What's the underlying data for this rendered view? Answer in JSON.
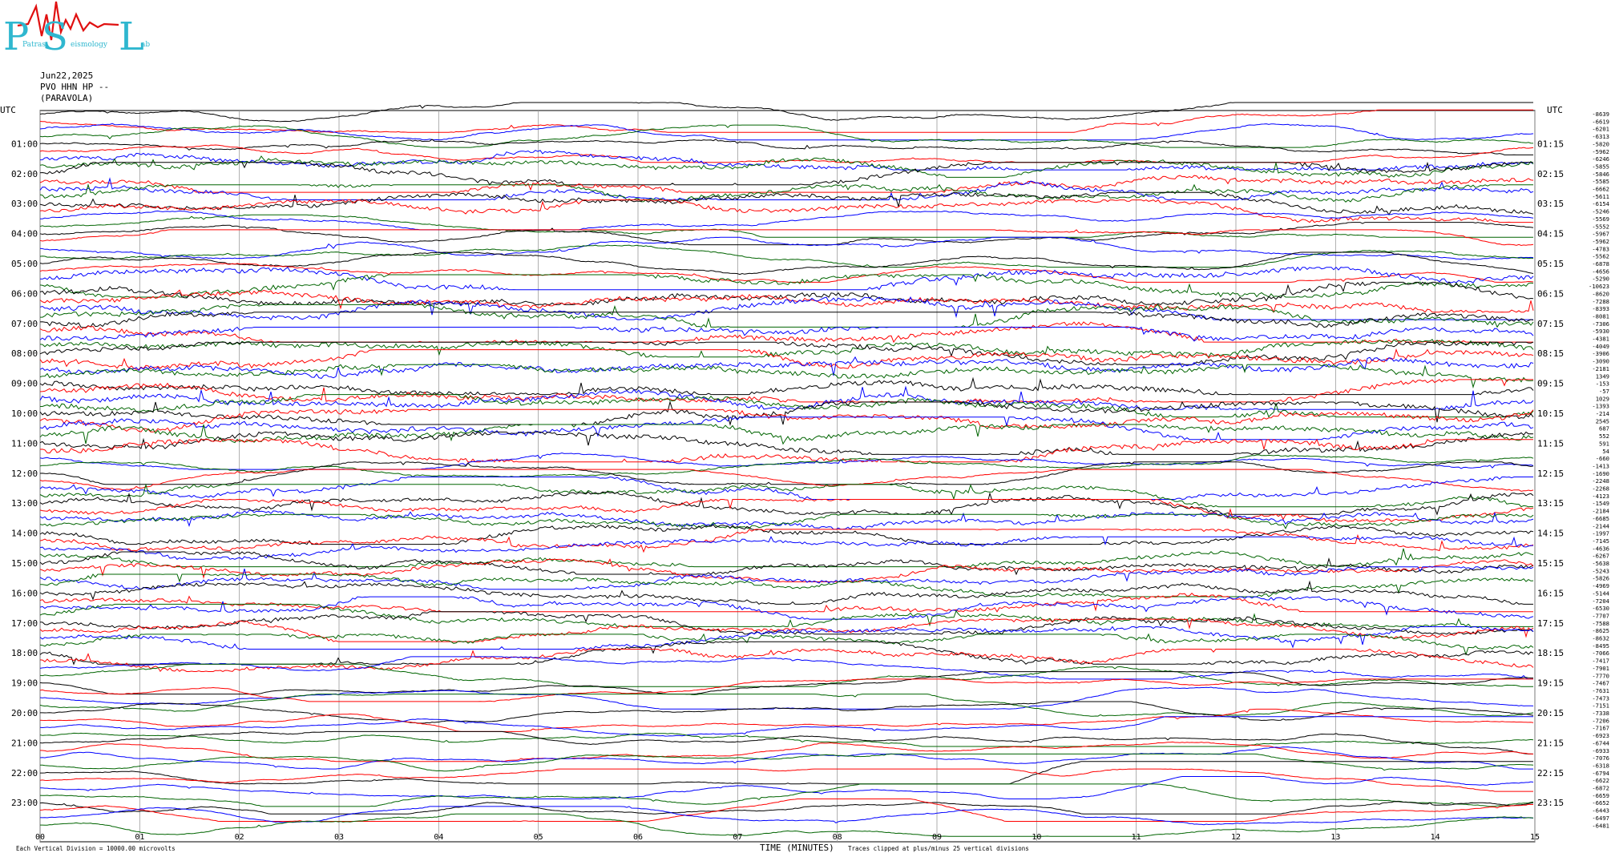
{
  "logo": {
    "big_letters": [
      "P",
      "S",
      "L"
    ],
    "small_words": [
      "Patras",
      "eismology",
      "ab"
    ],
    "colors": {
      "letters": "#2fb7cf",
      "waveform": "#e01010"
    }
  },
  "header": {
    "date": "Jun22,2025",
    "station": "PVO HHN HP --",
    "location": "(PARAVOLA)"
  },
  "axis": {
    "left_label": "UTC",
    "right_label": "UTC",
    "left_hours": [
      "01:00",
      "02:00",
      "03:00",
      "04:00",
      "05:00",
      "06:00",
      "07:00",
      "08:00",
      "09:00",
      "10:00",
      "11:00",
      "12:00",
      "13:00",
      "14:00",
      "15:00",
      "16:00",
      "17:00",
      "18:00",
      "19:00",
      "20:00",
      "21:00",
      "22:00",
      "23:00"
    ],
    "right_hours": [
      "01:15",
      "02:15",
      "03:15",
      "04:15",
      "05:15",
      "06:15",
      "07:15",
      "08:15",
      "09:15",
      "10:15",
      "11:15",
      "12:15",
      "13:15",
      "14:15",
      "15:15",
      "16:15",
      "17:15",
      "18:15",
      "19:15",
      "20:15",
      "21:15",
      "22:15",
      "23:15"
    ],
    "minute_ticks": [
      "00",
      "01",
      "02",
      "03",
      "04",
      "05",
      "06",
      "07",
      "08",
      "09",
      "10",
      "11",
      "12",
      "13",
      "14",
      "15"
    ],
    "xlabel": "TIME (MINUTES)"
  },
  "footer": {
    "scale_note": "Each Vertical Division = 10000.00 microvolts",
    "clip_note": "Traces clipped at plus/minus 25 vertical divisions"
  },
  "trace_colors": [
    "#000000",
    "#ff0000",
    "#0000ff",
    "#006400"
  ],
  "row_values": [
    "-8639",
    "-6619",
    "-6201",
    "-6313",
    "-5820",
    "-5962",
    "-6246",
    "-5855",
    "-5846",
    "-5585",
    "-6662",
    "-5611",
    "-6154",
    "-5246",
    "-5569",
    "-5552",
    "-5967",
    "-5962",
    "-4783",
    "-5562",
    "-6878",
    "-4656",
    "-5290",
    "-10623",
    "-8620",
    "-7288",
    "-8393",
    "-8081",
    "-7306",
    "-5930",
    "-4381",
    "-4049",
    "-3906",
    "-3090",
    "-2181",
    "1349",
    "-153",
    "-57",
    "1029",
    "-1393",
    "-214",
    "2545",
    "687",
    "552",
    "591",
    "54",
    "-660",
    "-1413",
    "-1690",
    "-2248",
    "-2268",
    "-4123",
    "-1549",
    "-2184",
    "-6685",
    "-2144",
    "-1997",
    "-7145",
    "-4636",
    "-6267",
    "-5638",
    "-5243",
    "-5826",
    "-4969",
    "-5144",
    "-7204",
    "-6530",
    "-7707",
    "-7588",
    "-8625",
    "-8632",
    "-8495",
    "-7066",
    "-7417",
    "-7901",
    "-7770",
    "-7467",
    "-7631",
    "-7473",
    "-7151",
    "-7338",
    "-7206",
    "-7167",
    "-6923",
    "-6744",
    "-6933",
    "-7076",
    "-6318",
    "-6794",
    "-6622",
    "-6872",
    "-6659",
    "-6652",
    "-6443",
    "-6497",
    "-6481"
  ],
  "trace_count": 96
}
